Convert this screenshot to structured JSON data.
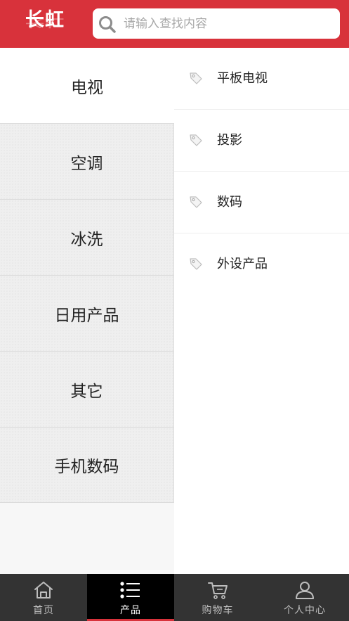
{
  "header": {
    "logo_text": "长虹",
    "search": {
      "placeholder": "请输入查找内容",
      "value": ""
    }
  },
  "categories": [
    {
      "label": "电视",
      "active": true
    },
    {
      "label": "空调",
      "active": false
    },
    {
      "label": "冰洗",
      "active": false
    },
    {
      "label": "日用产品",
      "active": false
    },
    {
      "label": "其它",
      "active": false
    },
    {
      "label": "手机数码",
      "active": false
    }
  ],
  "subcategories": [
    {
      "label": "平板电视",
      "icon": "tag-icon"
    },
    {
      "label": "投影",
      "icon": "tag-icon"
    },
    {
      "label": "数码",
      "icon": "tag-icon"
    },
    {
      "label": "外设产品",
      "icon": "tag-icon"
    }
  ],
  "bottom_nav": [
    {
      "label": "首页",
      "icon": "home-icon",
      "active": false
    },
    {
      "label": "产品",
      "icon": "list-icon",
      "active": true
    },
    {
      "label": "购物车",
      "icon": "cart-icon",
      "active": false
    },
    {
      "label": "个人中心",
      "icon": "user-icon",
      "active": false
    }
  ],
  "colors": {
    "brand_red": "#d8323b",
    "nav_bg": "#333333",
    "nav_active_bg": "#000000"
  }
}
